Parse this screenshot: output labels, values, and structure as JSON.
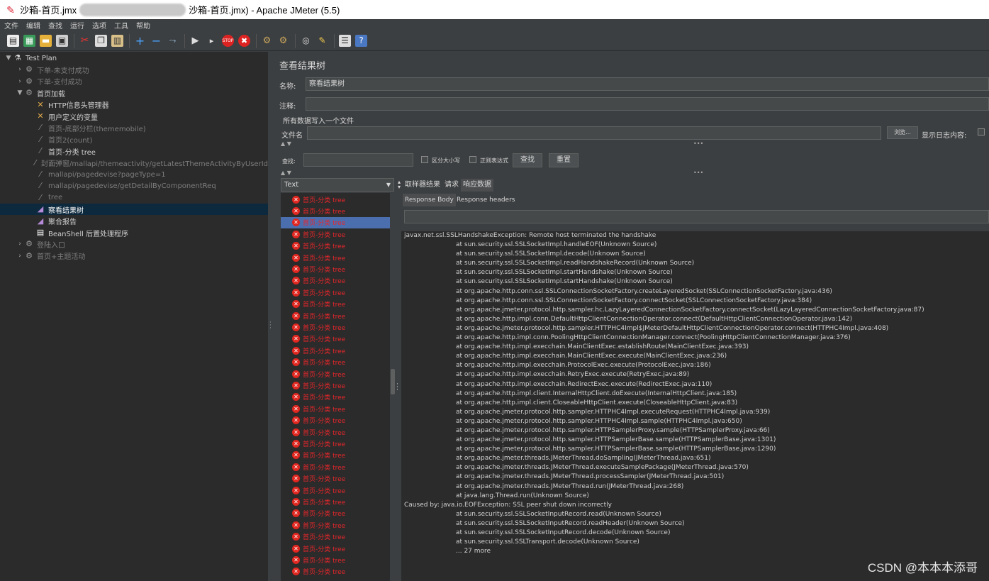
{
  "window": {
    "title_left": "沙箱-首页.jmx",
    "title_right": "沙箱-首页.jmx) - Apache JMeter (5.5)"
  },
  "menu": [
    "文件",
    "编辑",
    "查找",
    "运行",
    "选项",
    "工具",
    "帮助"
  ],
  "toolbar_icons": [
    "new-icon",
    "templates-icon",
    "open-icon",
    "save-icon",
    "cut-icon",
    "copy-icon",
    "paste-icon",
    "expand-icon",
    "collapse-icon",
    "toggle-icon",
    "start-icon",
    "start-no-pause-icon",
    "stop-icon",
    "shutdown-icon",
    "clear-icon",
    "clear-all-icon",
    "search-icon",
    "reset-search-icon",
    "function-helper-icon",
    "help-icon"
  ],
  "tree": [
    {
      "label": "Test Plan",
      "level": 0,
      "arrow": "▼",
      "icon": "test-plan-icon",
      "state": "normal"
    },
    {
      "label": "下单-未支付成功",
      "level": 1,
      "arrow": "›",
      "icon": "gear-icon",
      "state": "dim"
    },
    {
      "label": "下单-支付成功",
      "level": 1,
      "arrow": "›",
      "icon": "gear-icon",
      "state": "dim"
    },
    {
      "label": "首页加载",
      "level": 1,
      "arrow": "▼",
      "icon": "gear-icon",
      "state": "normal"
    },
    {
      "label": "HTTP信息头管理器",
      "level": 2,
      "arrow": "",
      "icon": "wrench-icon",
      "state": "normal"
    },
    {
      "label": "用户定义的变量",
      "level": 2,
      "arrow": "",
      "icon": "wrench-icon",
      "state": "normal"
    },
    {
      "label": "首页-底部分栏(thememobile)",
      "level": 2,
      "arrow": "",
      "icon": "pencil-icon",
      "state": "dim"
    },
    {
      "label": "首页2(count)",
      "level": 2,
      "arrow": "",
      "icon": "pencil-icon",
      "state": "dim"
    },
    {
      "label": "首页-分类 tree",
      "level": 2,
      "arrow": "",
      "icon": "pencil-icon",
      "state": "normal"
    },
    {
      "label": "封面弹窗/mallapi/themeactivity/getLatestThemeActivityByUserId",
      "level": 2,
      "arrow": "",
      "icon": "pencil-icon",
      "state": "dim"
    },
    {
      "label": "mallapi/pagedevise?pageType=1",
      "level": 2,
      "arrow": "",
      "icon": "pencil-icon",
      "state": "dim"
    },
    {
      "label": "mallapi/pagedevise/getDetailByComponentReq",
      "level": 2,
      "arrow": "",
      "icon": "pencil-icon",
      "state": "dim"
    },
    {
      "label": "tree",
      "level": 2,
      "arrow": "",
      "icon": "pencil-icon",
      "state": "dim"
    },
    {
      "label": "察看结果树",
      "level": 2,
      "arrow": "",
      "icon": "chart-icon",
      "state": "selected"
    },
    {
      "label": "聚合报告",
      "level": 2,
      "arrow": "",
      "icon": "chart-icon",
      "state": "normal"
    },
    {
      "label": "BeanShell 后置处理程序",
      "level": 2,
      "arrow": "",
      "icon": "script-icon",
      "state": "normal"
    },
    {
      "label": "登陆入口",
      "level": 1,
      "arrow": "›",
      "icon": "gear-icon",
      "state": "dim"
    },
    {
      "label": "首页+主题活动",
      "level": 1,
      "arrow": "›",
      "icon": "gear-icon",
      "state": "dim"
    }
  ],
  "panel": {
    "heading": "查看结果树",
    "name_label": "名称:",
    "name_value": "察看结果树",
    "comment_label": "注释:",
    "comment_value": "",
    "file_section": "所有数据写入一个文件",
    "file_label": "文件名",
    "file_value": "",
    "browse_button": "浏览...",
    "log_label": "显示日志内容:",
    "search_label": "查找:",
    "search_value": "",
    "case_label": "区分大小写",
    "regex_label": "正则表达式",
    "find_button": "查找",
    "reset_button": "重置",
    "renderer": "Text",
    "tabs": [
      "取样器结果",
      "请求",
      "响应数据"
    ],
    "subtabs": [
      "Response Body",
      "Response headers"
    ],
    "result_label": "首页-分类 tree",
    "result_count": 33
  },
  "trace": [
    {
      "t": "javax.net.ssl.SSLHandshakeException: Remote host terminated the handshake",
      "i": 0
    },
    {
      "t": "at sun.security.ssl.SSLSocketImpl.handleEOF(Unknown Source)",
      "i": 1
    },
    {
      "t": "at sun.security.ssl.SSLSocketImpl.decode(Unknown Source)",
      "i": 1
    },
    {
      "t": "at sun.security.ssl.SSLSocketImpl.readHandshakeRecord(Unknown Source)",
      "i": 1
    },
    {
      "t": "at sun.security.ssl.SSLSocketImpl.startHandshake(Unknown Source)",
      "i": 1
    },
    {
      "t": "at sun.security.ssl.SSLSocketImpl.startHandshake(Unknown Source)",
      "i": 1
    },
    {
      "t": "at org.apache.http.conn.ssl.SSLConnectionSocketFactory.createLayeredSocket(SSLConnectionSocketFactory.java:436)",
      "i": 1
    },
    {
      "t": "at org.apache.http.conn.ssl.SSLConnectionSocketFactory.connectSocket(SSLConnectionSocketFactory.java:384)",
      "i": 1
    },
    {
      "t": "at org.apache.jmeter.protocol.http.sampler.hc.LazyLayeredConnectionSocketFactory.connectSocket(LazyLayeredConnectionSocketFactory.java:87)",
      "i": 1
    },
    {
      "t": "at org.apache.http.impl.conn.DefaultHttpClientConnectionOperator.connect(DefaultHttpClientConnectionOperator.java:142)",
      "i": 1
    },
    {
      "t": "at org.apache.jmeter.protocol.http.sampler.HTTPHC4Impl$JMeterDefaultHttpClientConnectionOperator.connect(HTTPHC4Impl.java:408)",
      "i": 1
    },
    {
      "t": "at org.apache.http.impl.conn.PoolingHttpClientConnectionManager.connect(PoolingHttpClientConnectionManager.java:376)",
      "i": 1
    },
    {
      "t": "at org.apache.http.impl.execchain.MainClientExec.establishRoute(MainClientExec.java:393)",
      "i": 1
    },
    {
      "t": "at org.apache.http.impl.execchain.MainClientExec.execute(MainClientExec.java:236)",
      "i": 1
    },
    {
      "t": "at org.apache.http.impl.execchain.ProtocolExec.execute(ProtocolExec.java:186)",
      "i": 1
    },
    {
      "t": "at org.apache.http.impl.execchain.RetryExec.execute(RetryExec.java:89)",
      "i": 1
    },
    {
      "t": "at org.apache.http.impl.execchain.RedirectExec.execute(RedirectExec.java:110)",
      "i": 1
    },
    {
      "t": "at org.apache.http.impl.client.InternalHttpClient.doExecute(InternalHttpClient.java:185)",
      "i": 1
    },
    {
      "t": "at org.apache.http.impl.client.CloseableHttpClient.execute(CloseableHttpClient.java:83)",
      "i": 1
    },
    {
      "t": "at org.apache.jmeter.protocol.http.sampler.HTTPHC4Impl.executeRequest(HTTPHC4Impl.java:939)",
      "i": 1
    },
    {
      "t": "at org.apache.jmeter.protocol.http.sampler.HTTPHC4Impl.sample(HTTPHC4Impl.java:650)",
      "i": 1
    },
    {
      "t": "at org.apache.jmeter.protocol.http.sampler.HTTPSamplerProxy.sample(HTTPSamplerProxy.java:66)",
      "i": 1
    },
    {
      "t": "at org.apache.jmeter.protocol.http.sampler.HTTPSamplerBase.sample(HTTPSamplerBase.java:1301)",
      "i": 1
    },
    {
      "t": "at org.apache.jmeter.protocol.http.sampler.HTTPSamplerBase.sample(HTTPSamplerBase.java:1290)",
      "i": 1
    },
    {
      "t": "at org.apache.jmeter.threads.JMeterThread.doSampling(JMeterThread.java:651)",
      "i": 1
    },
    {
      "t": "at org.apache.jmeter.threads.JMeterThread.executeSamplePackage(JMeterThread.java:570)",
      "i": 1
    },
    {
      "t": "at org.apache.jmeter.threads.JMeterThread.processSampler(JMeterThread.java:501)",
      "i": 1
    },
    {
      "t": "at org.apache.jmeter.threads.JMeterThread.run(JMeterThread.java:268)",
      "i": 1
    },
    {
      "t": "at java.lang.Thread.run(Unknown Source)",
      "i": 1
    },
    {
      "t": "Caused by: java.io.EOFException: SSL peer shut down incorrectly",
      "i": 0
    },
    {
      "t": "at sun.security.ssl.SSLSocketInputRecord.read(Unknown Source)",
      "i": 1
    },
    {
      "t": "at sun.security.ssl.SSLSocketInputRecord.readHeader(Unknown Source)",
      "i": 1
    },
    {
      "t": "at sun.security.ssl.SSLSocketInputRecord.decode(Unknown Source)",
      "i": 1
    },
    {
      "t": "at sun.security.ssl.SSLTransport.decode(Unknown Source)",
      "i": 1
    },
    {
      "t": "... 27 more",
      "i": 1
    }
  ],
  "watermark": "CSDN @本本本添哥",
  "colors": {
    "error": "#e8262b",
    "selection": "#4b6eaf",
    "background": "#3c3f41"
  }
}
